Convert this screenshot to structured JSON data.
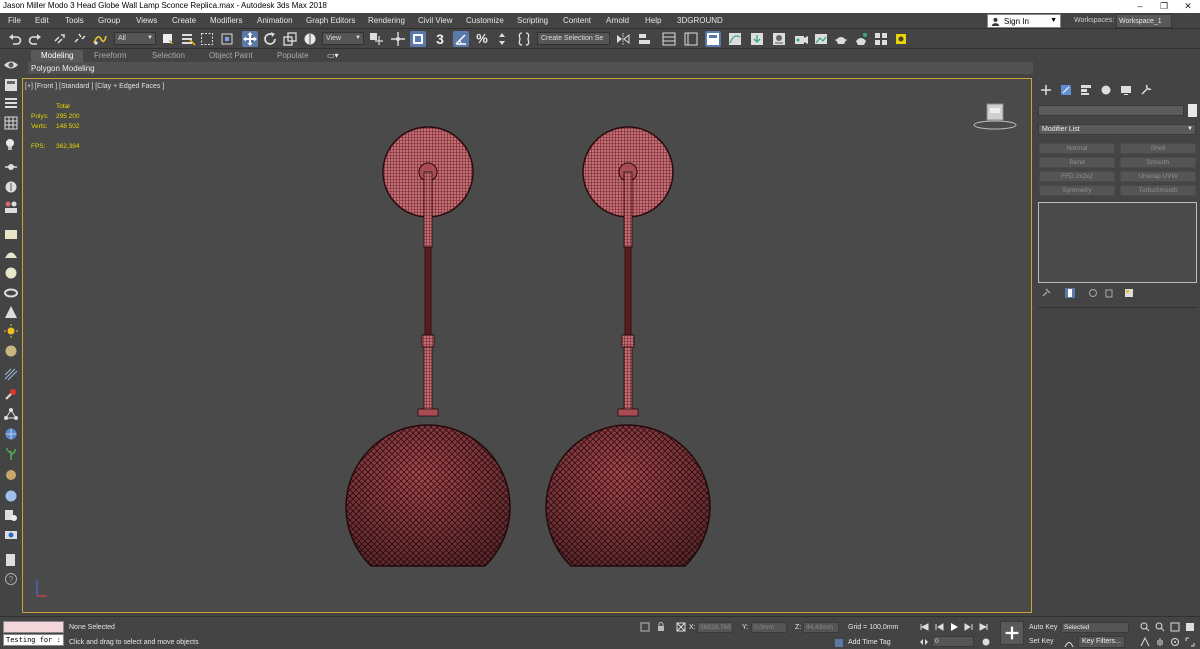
{
  "window": {
    "title": "Jason Miller Modo 3 Head Globe Wall Lamp Sconce Replica.max - Autodesk 3ds Max 2018",
    "minimize": "–",
    "restore": "❐",
    "close": "✕"
  },
  "menu": [
    "File",
    "Edit",
    "Tools",
    "Group",
    "Views",
    "Create",
    "Modifiers",
    "Animation",
    "Graph Editors",
    "Rendering",
    "Civil View",
    "Customize",
    "Scripting",
    "Content",
    "Arnold",
    "Help",
    "3DGROUND"
  ],
  "account": {
    "signin_label": "Sign In",
    "workspaces_label": "Workspaces:",
    "workspace_value": "Workspace_1"
  },
  "toolbar": {
    "selection_filter": "All",
    "coord_system": "View",
    "snaps_value": "3",
    "named_selection": "Create Selection Se"
  },
  "ribbon": {
    "tabs": [
      "Modeling",
      "Freeform",
      "Selection",
      "Object Paint",
      "Populate"
    ],
    "active_tab": "Modeling",
    "panel_label": "Polygon Modeling"
  },
  "viewport": {
    "label": "[+] [Front ] [Standard ] [Clay + Edged Faces ]",
    "stats": {
      "header": "Total",
      "polys_label": "Polys:",
      "polys_value": "295 200",
      "verts_label": "Verts:",
      "verts_value": "148 502",
      "fps_label": "FPS:",
      "fps_value": "362,384"
    },
    "mesh_color": "#a0484e",
    "wire_color": "#2a0b0d"
  },
  "command_panel": {
    "modifier_list": "Modifier List",
    "modifier_buttons": [
      "Normal",
      "Shell",
      "Bend",
      "Smooth",
      "FFD 2x2x2",
      "Unwrap UVW",
      "Symmetry",
      "TurboSmooth"
    ]
  },
  "status": {
    "listener_text": "Testing for :",
    "selection_status": "None Selected",
    "prompt": "Click and drag to select and move objects",
    "x_label": "X:",
    "x_value": "38828,768",
    "y_label": "Y:",
    "y_value": "0,0mm",
    "z_label": "Z:",
    "z_value": "44,43mm",
    "grid": "Grid = 100,0mm",
    "add_time_tag": "Add Time Tag",
    "frame_value": "0",
    "auto_key": "Auto Key",
    "set_key": "Set Key",
    "key_mode": "Selected",
    "key_filters": "Key Filters..."
  }
}
